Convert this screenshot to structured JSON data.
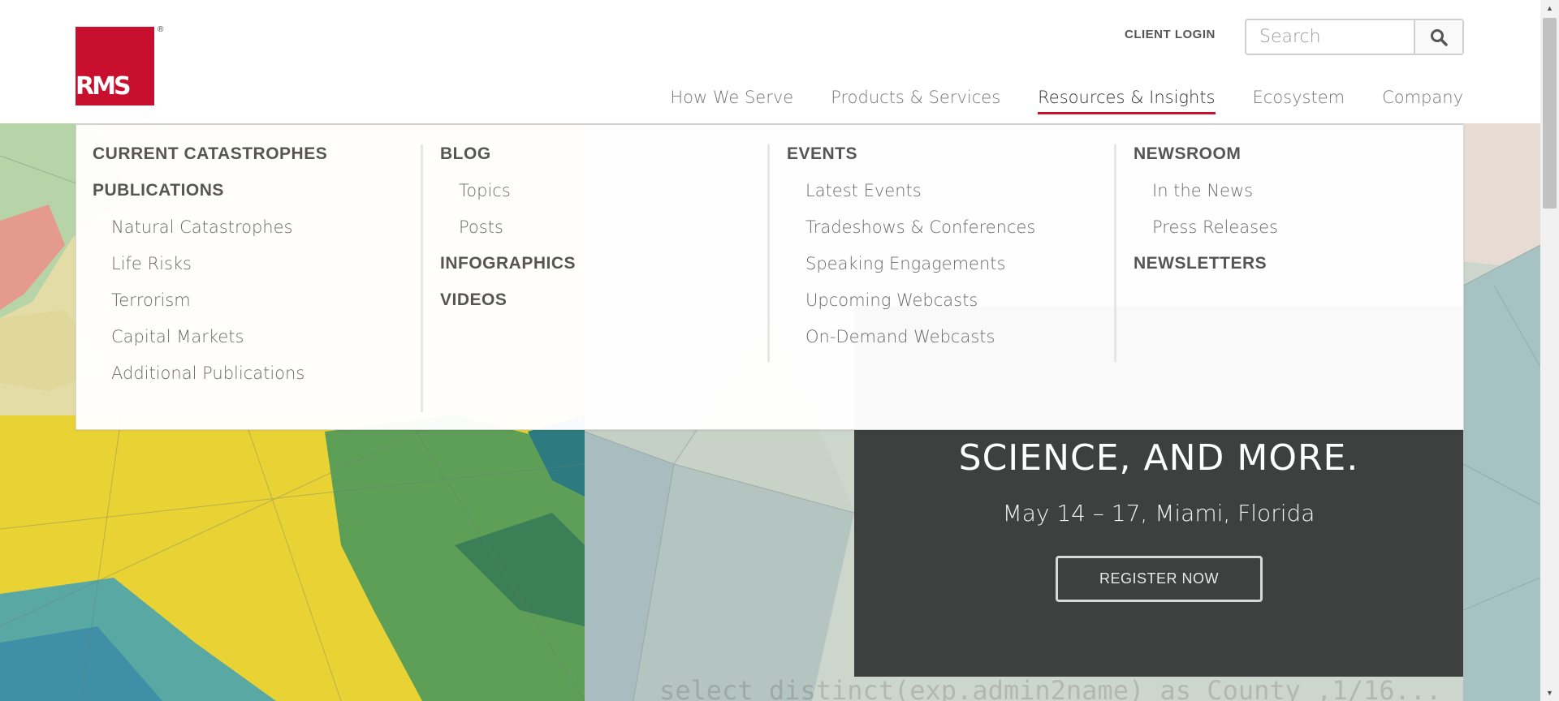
{
  "header": {
    "logo_text": "RMS",
    "logo_reg": "®",
    "client_login": "CLIENT LOGIN",
    "search_placeholder": "Search"
  },
  "nav": [
    {
      "label": "How We Serve",
      "active": false
    },
    {
      "label": "Products & Services",
      "active": false
    },
    {
      "label": "Resources & Insights",
      "active": true
    },
    {
      "label": "Ecosystem",
      "active": false
    },
    {
      "label": "Company",
      "active": false
    }
  ],
  "mega_menu": {
    "columns": [
      {
        "sections": [
          {
            "title": "CURRENT CATASTROPHES",
            "items": []
          },
          {
            "title": "PUBLICATIONS",
            "items": [
              "Natural Catastrophes",
              "Life Risks",
              "Terrorism",
              "Capital Markets",
              "Additional Publications"
            ]
          }
        ]
      },
      {
        "sections": [
          {
            "title": "BLOG",
            "items": [
              "Topics",
              "Posts"
            ]
          },
          {
            "title": "INFOGRAPHICS",
            "items": []
          },
          {
            "title": "VIDEOS",
            "items": []
          }
        ]
      },
      {
        "sections": [
          {
            "title": "EVENTS",
            "items": [
              "Latest Events",
              "Tradeshows & Conferences",
              "Speaking Engagements",
              "Upcoming Webcasts",
              "On-Demand Webcasts"
            ]
          }
        ]
      },
      {
        "sections": [
          {
            "title": "NEWSROOM",
            "items": [
              "In the News",
              "Press Releases"
            ]
          },
          {
            "title": "NEWSLETTERS",
            "items": []
          }
        ]
      }
    ]
  },
  "hero": {
    "heading": "SCIENCE, AND MORE.",
    "date": "May 14 – 17, Miami, Florida",
    "cta": "REGISTER NOW",
    "code_text": "select distinct(exp.admin2name) as County ,1/16..."
  },
  "colors": {
    "brand_red": "#c8102e",
    "event_box": "#3e3f3f"
  }
}
